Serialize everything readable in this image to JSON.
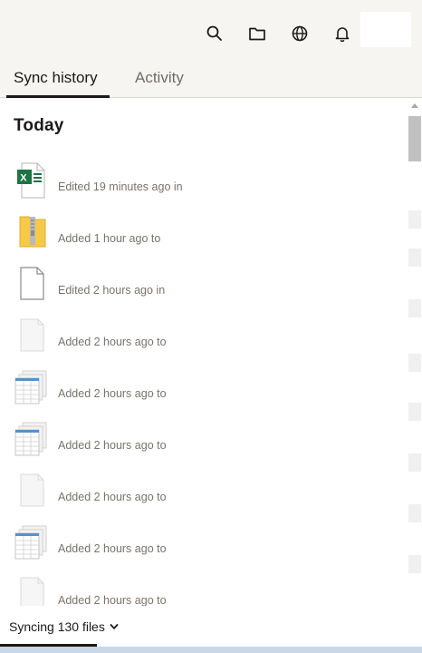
{
  "header": {
    "icons": [
      "search-icon",
      "folder-icon",
      "globe-icon",
      "bell-icon"
    ]
  },
  "tabs": [
    {
      "label": "Sync history",
      "active": true
    },
    {
      "label": "Activity",
      "active": false
    }
  ],
  "section_title": "Today",
  "items": [
    {
      "icon": "excel-file-icon",
      "text": "Edited 19 minutes ago in"
    },
    {
      "icon": "zip-folder-icon",
      "text": "Added 1 hour ago to"
    },
    {
      "icon": "document-icon",
      "text": "Edited 2 hours ago in"
    },
    {
      "icon": "blank-file-icon",
      "text": "Added 2 hours ago to"
    },
    {
      "icon": "spreadsheet-stack-icon",
      "text": "Added 2 hours ago to"
    },
    {
      "icon": "spreadsheet-stack-icon",
      "text": "Added 2 hours ago to"
    },
    {
      "icon": "blank-file-icon",
      "text": "Added 2 hours ago to"
    },
    {
      "icon": "spreadsheet-stack-icon",
      "text": "Added 2 hours ago to"
    },
    {
      "icon": "blank-file-icon",
      "text": "Added 2 hours ago to"
    }
  ],
  "footer": {
    "sync_status": "Syncing 130 files",
    "progress": 0.23
  }
}
